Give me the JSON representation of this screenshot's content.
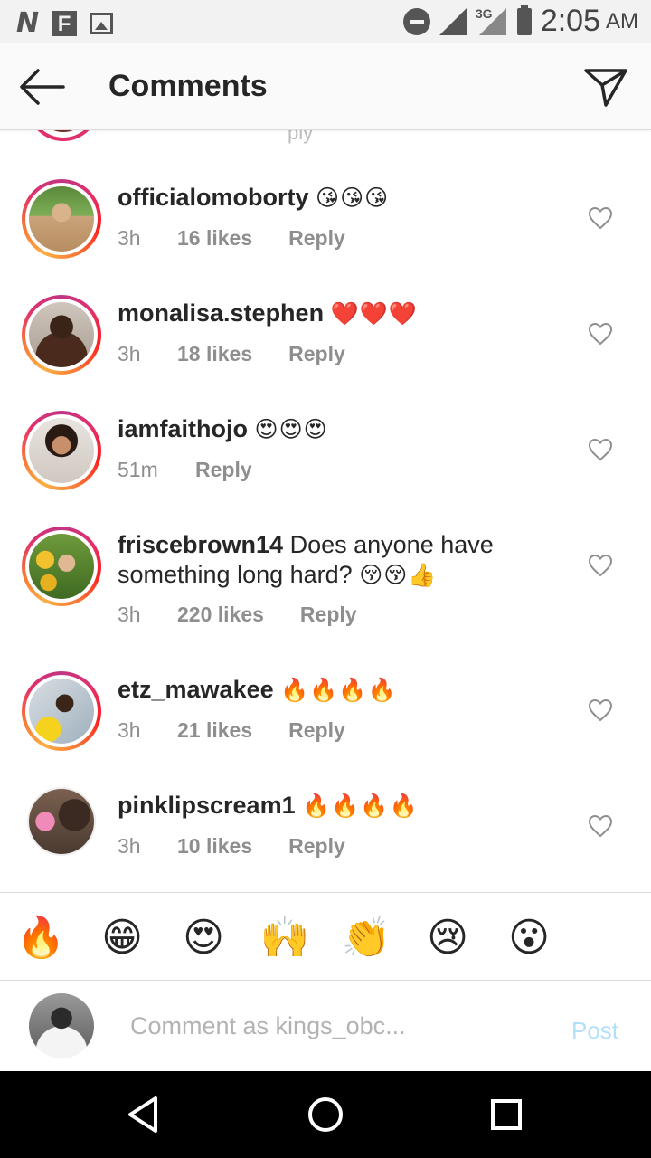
{
  "status_bar": {
    "left_icons": [
      "n-app-icon",
      "flipboard-icon",
      "gallery-icon"
    ],
    "network": "3G",
    "time": "2:05",
    "ampm": "AM"
  },
  "header": {
    "title": "Comments"
  },
  "partial_top": {
    "reply_fragment": "ply"
  },
  "comments": [
    {
      "username": "officialomoborty",
      "text": "",
      "emoji": "😘😘😘",
      "time": "3h",
      "likes": "16 likes",
      "reply": "Reply"
    },
    {
      "username": "monalisa.stephen",
      "text": "",
      "emoji": "❤️❤️❤️",
      "time": "3h",
      "likes": "18 likes",
      "reply": "Reply"
    },
    {
      "username": "iamfaithojo",
      "text": "",
      "emoji": "😍😍😍",
      "time": "51m",
      "likes": "",
      "reply": "Reply"
    },
    {
      "username": "friscebrown14",
      "text": "Does anyone have something long hard?",
      "emoji": "😚😚👍",
      "time": "3h",
      "likes": "220 likes",
      "reply": "Reply"
    },
    {
      "username": "etz_mawakee",
      "text": "",
      "emoji": "🔥🔥🔥🔥",
      "time": "3h",
      "likes": "21 likes",
      "reply": "Reply"
    },
    {
      "username": "pinklipscream1",
      "text": "",
      "emoji": "🔥🔥🔥🔥",
      "time": "3h",
      "likes": "10 likes",
      "reply": "Reply"
    }
  ],
  "emoji_bar": [
    "🔥",
    "😁",
    "😍",
    "🙌",
    "👏",
    "😢",
    "😮"
  ],
  "compose": {
    "placeholder": "Comment as kings_obc...",
    "post_label": "Post"
  },
  "colors": {
    "post_disabled": "#b2dffc",
    "meta_gray": "#8e8e8e",
    "story_ring": "#e1306c"
  }
}
